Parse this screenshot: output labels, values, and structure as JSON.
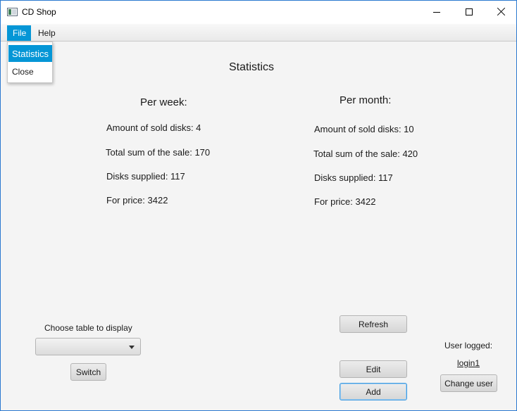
{
  "window": {
    "title": "CD Shop"
  },
  "menubar": {
    "file": "File",
    "help": "Help"
  },
  "file_menu": {
    "items": [
      "Statistics",
      "Close"
    ],
    "highlighted": "Statistics"
  },
  "stats": {
    "title": "Statistics",
    "week": {
      "heading": "Per week:",
      "sold": "Amount of sold disks: 4",
      "total": "Total sum of the sale: 170",
      "supplied": "Disks supplied: 117",
      "price": "For price: 3422"
    },
    "month": {
      "heading": "Per month:",
      "sold": "Amount of sold disks: 10",
      "total": "Total sum of the sale: 420",
      "supplied": "Disks supplied: 117",
      "price": "For price: 3422"
    }
  },
  "table_chooser": {
    "label": "Choose table to display",
    "selected": "",
    "switch_label": "Switch"
  },
  "actions": {
    "refresh": "Refresh",
    "edit": "Edit",
    "add": "Add"
  },
  "user": {
    "label": "User logged:",
    "name": "login1",
    "change_label": "Change user"
  },
  "colors": {
    "accent": "#0596d6",
    "window_border": "#2b79d0",
    "background": "#f4f4f4"
  }
}
